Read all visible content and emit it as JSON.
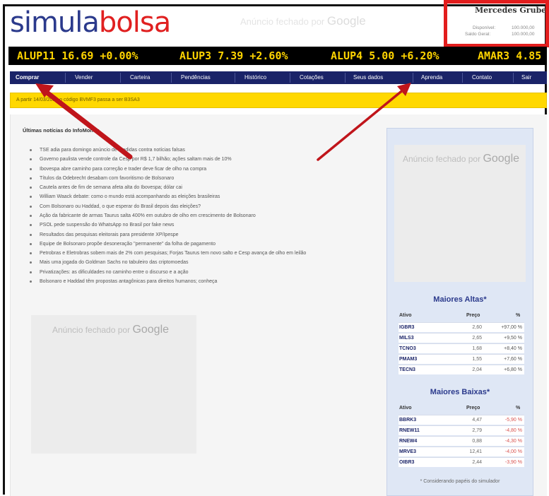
{
  "header": {
    "logo_part1": "simula",
    "logo_part2": "bolsa",
    "ad_prefix": "Anúncio fechado por",
    "ad_brand": "Google",
    "user_name": "Mercedes Gruber",
    "available_label": "Disponível:",
    "available_value": "100.000,00",
    "balance_label": "Saldo Geral:",
    "balance_value": "100.000,00"
  },
  "ticker": [
    {
      "symbol": "ALUP11",
      "price": "16.69",
      "change": "+0.00%"
    },
    {
      "symbol": "ALUP3",
      "price": "7.39",
      "change": "+2.60%"
    },
    {
      "symbol": "ALUP4",
      "price": "5.00",
      "change": "+6.20%"
    },
    {
      "symbol": "AMAR3",
      "price": "4.85",
      "change": ""
    }
  ],
  "nav": [
    "Comprar",
    "Vender",
    "Carteira",
    "Pendências",
    "Histórico",
    "Cotações",
    "Seus dados",
    "Aprenda",
    "Contato",
    "Sair"
  ],
  "notice": "A partir 14/03/2018 o código BVMF3 passa a ser B3SA3",
  "news": {
    "title": "Últimas notícias do InfoMoney",
    "items": [
      "TSE adia para domingo anúncio de medidas contra notícias falsas",
      "Governo paulista vende controle da Cesp por R$ 1,7 bilhão; ações saltam mais de 10%",
      "Ibovespa abre caminho para correção e trader deve ficar de olho na compra",
      "Títulos da Odebrecht desabam com favoritismo de Bolsonaro",
      "Cautela antes de fim de semana afeta alta do Ibovespa; dólar cai",
      "William Waack debate: como o mundo está acompanhando as eleições brasileiras",
      "Com Bolsonaro ou Haddad, o que esperar do Brasil depois das eleições?",
      "Ação da fabricante de armas Taurus salta 400% em outubro de olho em crescimento de Bolsonaro",
      "PSOL pede suspensão do WhatsApp no Brasil por fake news",
      "Resultados das pesquisas eleitorais para presidente XP/Ipespe",
      "Equipe de Bolsonaro propõe desoneração \"permanente\" da folha de pagamento",
      "Petrobras e Eletrobras sobem mais de 2% com pesquisas; Forjas Taurus tem novo salto e Cesp avança de olho em leilão",
      "Mais uma jogada do Goldman Sachs no tabuleiro das criptomoedas",
      "Privatizações: as dificuldades no caminho entre o discurso e a ação",
      "Bolsonaro e Haddad têm propostas antagônicas para direitos humanos; conheça"
    ]
  },
  "ads": {
    "prefix": "Anúncio fechado por",
    "brand": "Google"
  },
  "gainers": {
    "title": "Maiores Altas*",
    "col_asset": "Ativo",
    "col_price": "Preço",
    "col_pct": "%",
    "rows": [
      {
        "symbol": "IGBR3",
        "price": "2,60",
        "pct": "+97,00 %"
      },
      {
        "symbol": "MILS3",
        "price": "2,65",
        "pct": "+9,50 %"
      },
      {
        "symbol": "TCNO3",
        "price": "1,68",
        "pct": "+8,40 %"
      },
      {
        "symbol": "PMAM3",
        "price": "1,55",
        "pct": "+7,60 %"
      },
      {
        "symbol": "TECN3",
        "price": "2,04",
        "pct": "+6,80 %"
      }
    ]
  },
  "losers": {
    "title": "Maiores Baixas*",
    "col_asset": "Ativo",
    "col_price": "Preço",
    "col_pct": "%",
    "rows": [
      {
        "symbol": "BBRK3",
        "price": "4,47",
        "pct": "-5,90 %"
      },
      {
        "symbol": "RNEW11",
        "price": "2,79",
        "pct": "-4,80 %"
      },
      {
        "symbol": "RNEW4",
        "price": "0,88",
        "pct": "-4,30 %"
      },
      {
        "symbol": "MRVE3",
        "price": "12,41",
        "pct": "-4,00 %"
      },
      {
        "symbol": "OIBR3",
        "price": "2,44",
        "pct": "-3,90 %"
      }
    ]
  },
  "footnote": "* Considerando papéis do simulador",
  "colors": {
    "brand_blue": "#2b3a8c",
    "brand_red": "#e02020",
    "ticker_yellow": "#ffd400",
    "annotation_red": "#c0151b"
  }
}
